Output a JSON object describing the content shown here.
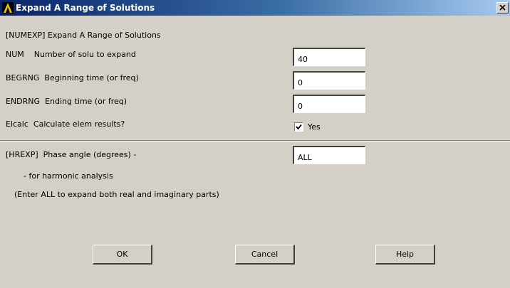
{
  "window": {
    "title": "Expand A Range of Solutions",
    "app_icon": "ansys-logo-icon",
    "close_icon": "close-icon"
  },
  "form": {
    "heading": "[NUMEXP] Expand A Range of Solutions",
    "num": {
      "label": "NUM    Number of solu to expand",
      "value": "40"
    },
    "begrng": {
      "label": "BEGRNG  Beginning time (or freq)",
      "value": "0"
    },
    "endrng": {
      "label": "ENDRNG  Ending time (or freq)",
      "value": "0"
    },
    "elcalc": {
      "label": "Elcalc  Calculate elem results?",
      "checked": true,
      "checkbox_label": "Yes"
    },
    "hrexp": {
      "label": "[HREXP]  Phase angle (degrees) -",
      "value": "ALL",
      "note1": "- for harmonic analysis",
      "note2": "(Enter ALL to expand both real and imaginary parts)"
    }
  },
  "buttons": {
    "ok": "OK",
    "cancel": "Cancel",
    "help": "Help"
  },
  "colors": {
    "titlebar_start": "#0a246a",
    "titlebar_end": "#a6caf0",
    "dialog_bg": "#d4d0c8"
  }
}
